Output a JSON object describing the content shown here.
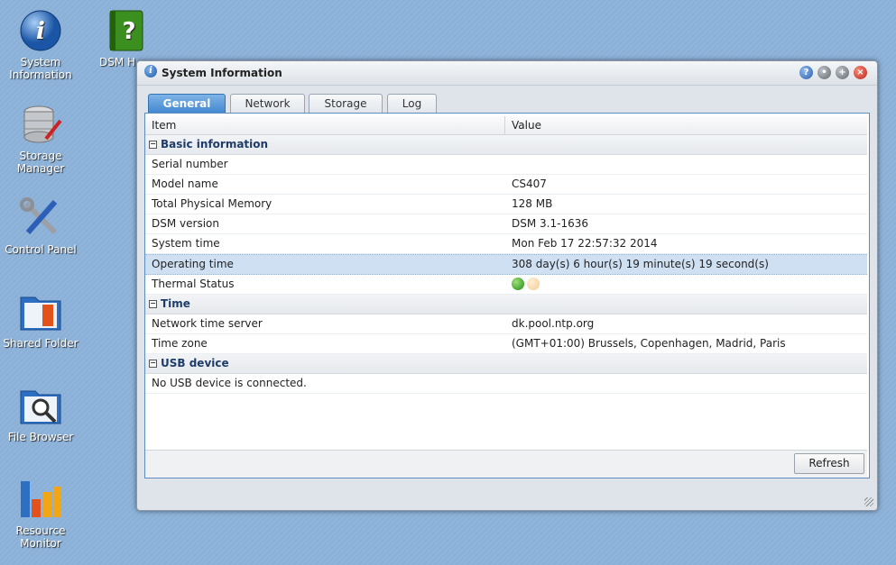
{
  "desktop": {
    "icons": [
      {
        "label": "System Information"
      },
      {
        "label": "DSM H"
      },
      {
        "label": "Storage Manager"
      },
      {
        "label": "Control Panel"
      },
      {
        "label": "Shared Folder"
      },
      {
        "label": "File Browser"
      },
      {
        "label": "Resource Monitor"
      }
    ]
  },
  "window": {
    "title": "System Information",
    "tabs": [
      {
        "label": "General",
        "active": true
      },
      {
        "label": "Network"
      },
      {
        "label": "Storage"
      },
      {
        "label": "Log"
      }
    ],
    "columns": {
      "item": "Item",
      "value": "Value"
    },
    "groups": [
      {
        "label": "Basic information",
        "rows": [
          {
            "item": "Serial number",
            "value": ""
          },
          {
            "item": "Model name",
            "value": "CS407"
          },
          {
            "item": "Total Physical Memory",
            "value": "128 MB"
          },
          {
            "item": "DSM version",
            "value": "DSM 3.1-1636"
          },
          {
            "item": "System time",
            "value": "Mon Feb 17 22:57:32 2014"
          },
          {
            "item": "Operating time",
            "value": "308 day(s) 6 hour(s) 19 minute(s) 19 second(s)"
          },
          {
            "item": "Thermal Status",
            "value": ""
          }
        ]
      },
      {
        "label": "Time",
        "rows": [
          {
            "item": "Network time server",
            "value": "dk.pool.ntp.org"
          },
          {
            "item": "Time zone",
            "value": "(GMT+01:00) Brussels, Copenhagen, Madrid, Paris"
          }
        ]
      },
      {
        "label": "USB device",
        "rows": [
          {
            "item": "No USB device is connected.",
            "value": ""
          }
        ]
      }
    ],
    "refresh_label": "Refresh",
    "thermal_indicators": {
      "normal": "#2e9a1c",
      "warning": "#f6cf9a"
    }
  }
}
